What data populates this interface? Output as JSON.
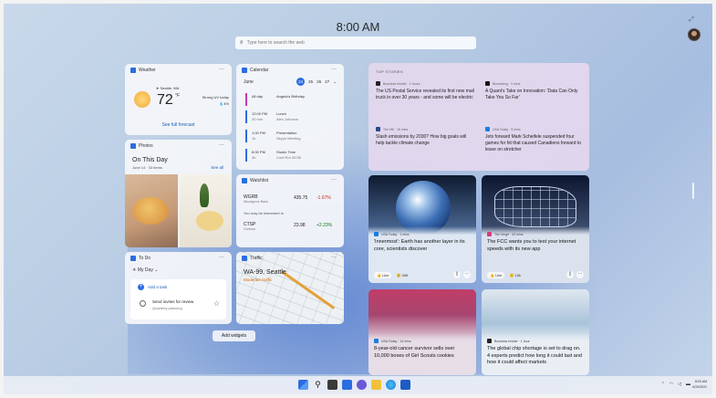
{
  "header": {
    "time": "8:00 AM",
    "search_placeholder": "Type here to search the web"
  },
  "weather": {
    "title": "Weather",
    "location": "Seattle, WA",
    "temp": "72",
    "unit": "°F",
    "condition": "Strong UV today",
    "precip": "4%",
    "link": "See full forecast"
  },
  "photos": {
    "title": "Photos",
    "heading": "On This Day",
    "sub": "June 14 · 33 items",
    "see_all": "See all"
  },
  "todo": {
    "title": "To Do",
    "list": "My Day",
    "add": "Add a task",
    "task": "Send invites for review",
    "task_sub": "Quarterly planning"
  },
  "calendar": {
    "title": "Calendar",
    "month": "June",
    "days": [
      "24",
      "25",
      "26",
      "27"
    ],
    "events": [
      {
        "time": "All day",
        "dur": "",
        "name": "Angela's Birthday",
        "detail": ""
      },
      {
        "time": "12:00 PM",
        "dur": "30 min",
        "name": "Lunch",
        "detail": "Alex Johnson"
      },
      {
        "time": "1:00 PM",
        "dur": "1h",
        "name": "Presentation",
        "detail": "Skype Meeting"
      },
      {
        "time": "6:00 PM",
        "dur": "3h",
        "name": "Studio Time",
        "detail": "Conf Rm 32/35"
      }
    ]
  },
  "watchlist": {
    "title": "Watchlist",
    "stocks": [
      {
        "symbol": "WGRB",
        "name": "Woodgrove Bank",
        "price": "435.75",
        "change": "-1.67%"
      },
      {
        "symbol": "CTSP",
        "name": "Contoso",
        "price": "23.98",
        "change": "+2.23%"
      }
    ],
    "interest": "You may be interested in"
  },
  "traffic": {
    "title": "Traffic",
    "road": "WA-99, Seattle",
    "status": "Moderate traffic"
  },
  "add_widgets": "Add widgets",
  "top_stories": {
    "heading": "TOP STORIES",
    "items": [
      {
        "source": "Business Insider · 2 hours",
        "headline": "The US Postal Service revealed its first new mail truck in over 30 years - and some will be electric"
      },
      {
        "source": "Bloomberg · 3 mins",
        "headline": "A Quant's Take on Innovation: 'Data Can Only Take You So Far'"
      },
      {
        "source": "The Hill · 18 mins",
        "headline": "Slash emissions by 2030? How big goals will help tackle climate change"
      },
      {
        "source": "USA Today · 5 mins",
        "headline": "Jets forward Mark Scheifele suspended four games for hit that caused Canadiens forward to leave on stretcher"
      }
    ]
  },
  "news": [
    {
      "source": "USA Today · 1 mins",
      "headline": "'Innermost': Earth has another layer in its core, scientists discover",
      "likes": "496"
    },
    {
      "source": "The Verge · 42 mins",
      "headline": "The FCC wants you to test your internet speeds with its new app",
      "likes": "13k"
    },
    {
      "source": "USA Today · 14 mins",
      "headline": "8-year-old cancer survivor sells over 10,000 boxes of Girl Scouts cookies"
    },
    {
      "source": "Business Insider · 1 hour",
      "headline": "The global chip shortage is set to drag on. 4 experts predict how long it could last and how it could affect markets"
    }
  ],
  "like_label": "Like",
  "taskbar": {
    "time": "8:00 AM",
    "date": "6/24/2021"
  }
}
